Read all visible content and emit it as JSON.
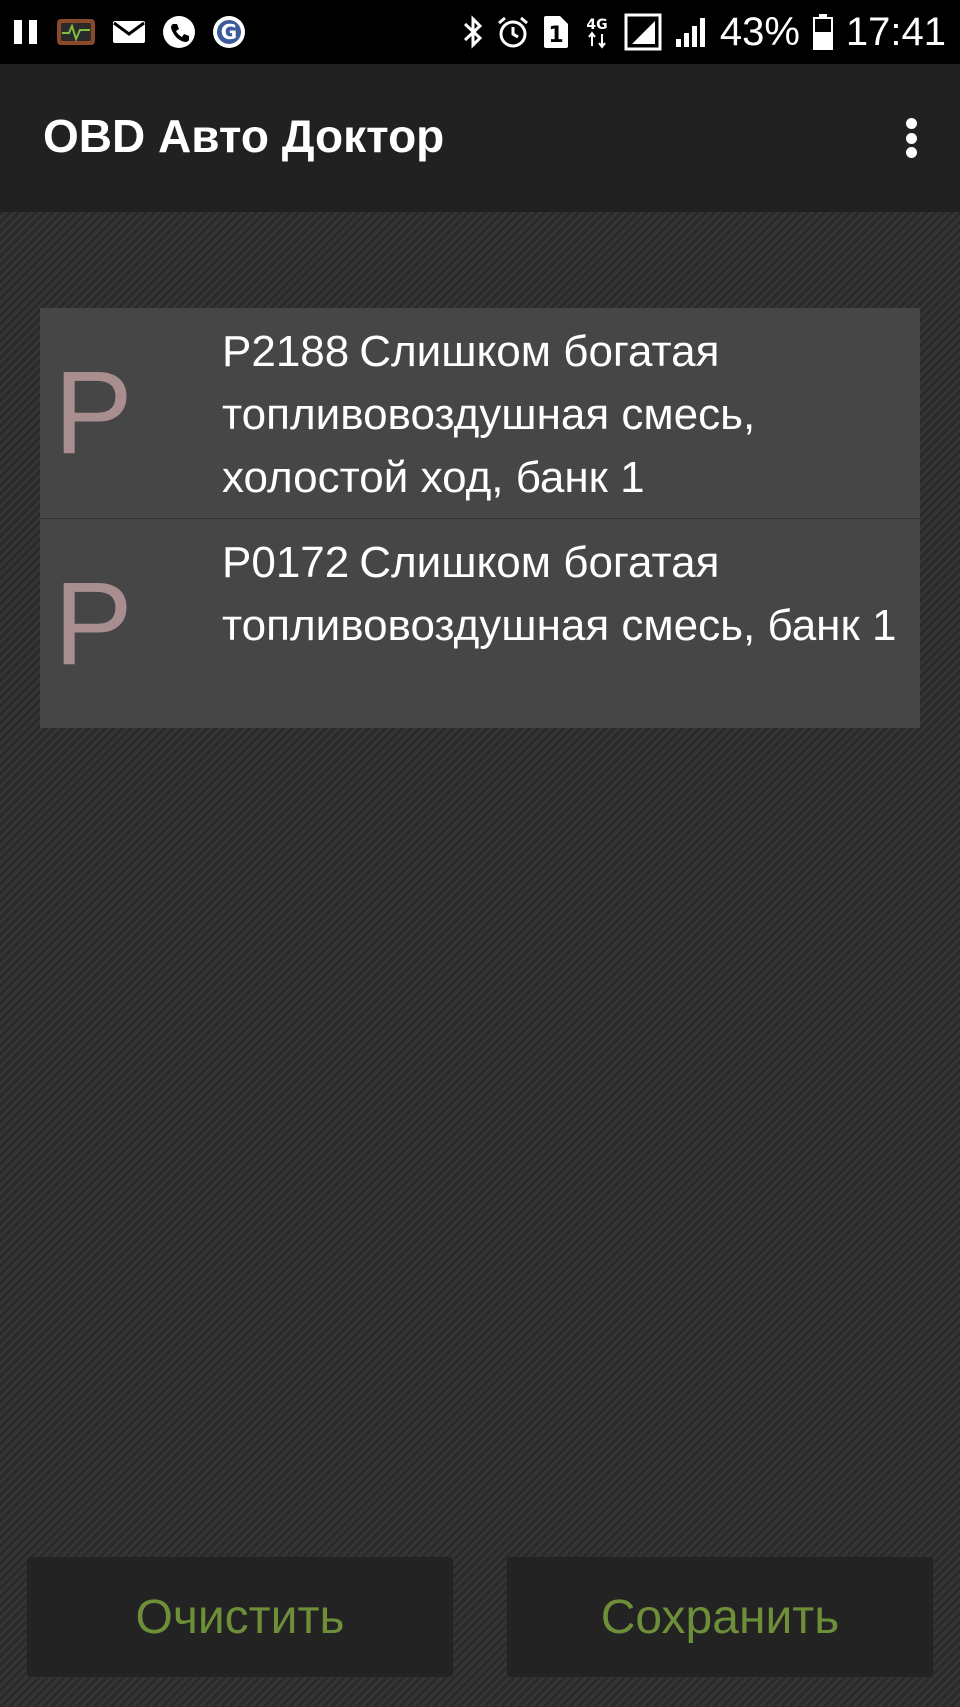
{
  "status_bar": {
    "icons_left": [
      "pause-icon",
      "obd-app-icon",
      "mail-icon",
      "phone-icon",
      "g-app-icon"
    ],
    "icons_right": [
      "bluetooth-icon",
      "alarm-icon",
      "sim1-icon",
      "4g-icon",
      "signal-icon",
      "signal-icon-2",
      "battery-icon"
    ],
    "sim": "1",
    "network": "4G",
    "battery": "43%",
    "time": "17:41"
  },
  "app_bar": {
    "title": "OBD Авто Доктор",
    "menu_icon": "more-vert-icon"
  },
  "codes": [
    {
      "letter": "P",
      "code": "P2188",
      "description": "Слишком богатая топливовоздушная смесь, холостой ход, банк 1"
    },
    {
      "letter": "P",
      "code": "P0172",
      "description": "Слишком богатая топливовоздушная смесь, банк 1"
    }
  ],
  "buttons": {
    "clear": "Очистить",
    "save": "Сохранить"
  },
  "colors": {
    "accent_text": "#6d8f3a",
    "letter": "#a88e8e",
    "list_item_bg": "#464646",
    "app_bar_bg": "#212121"
  }
}
